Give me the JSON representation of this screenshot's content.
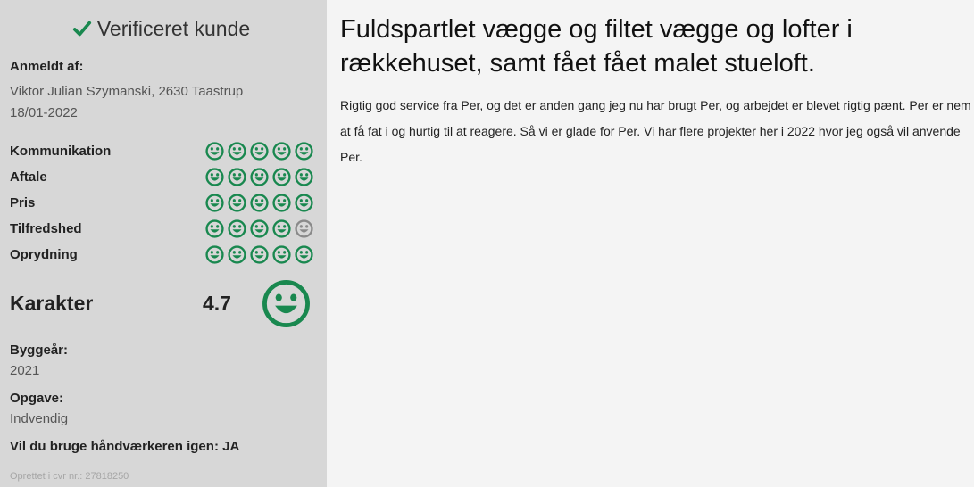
{
  "sidebar": {
    "verified_label": "Verificeret kunde",
    "reviewed_by_label": "Anmeldt af:",
    "reviewer": "Viktor Julian Szymanski, 2630 Taastrup",
    "date": "18/01-2022",
    "ratings": [
      {
        "label": "Kommunikation",
        "score": 5
      },
      {
        "label": "Aftale",
        "score": 5
      },
      {
        "label": "Pris",
        "score": 5
      },
      {
        "label": "Tilfredshed",
        "score": 4
      },
      {
        "label": "Oprydning",
        "score": 5
      }
    ],
    "grade_label": "Karakter",
    "grade_value": "4.7",
    "build_year_label": "Byggeår:",
    "build_year": "2021",
    "task_label": "Opgave:",
    "task": "Indvendig",
    "reuse": "Vil du bruge håndværkeren igen: JA",
    "cvr": "Oprettet i cvr nr.: 27818250"
  },
  "main": {
    "title": "Fuldspartlet vægge og filtet vægge og lofter i rækkehuset, samt fået fået malet stueloft.",
    "text": "Rigtig god service fra Per, og det er anden gang jeg nu har brugt Per, og arbejdet er blevet rigtig pænt. Per er nem at få fat i og hurtig til at reagere. Så vi er glade for Per. Vi har flere projekter her i 2022 hvor jeg også vil anvende Per."
  },
  "colors": {
    "accent_green": "#19884f",
    "inactive_gray": "#8a8a8a"
  },
  "icons": {
    "verified": "check-icon",
    "rating_face": "smiley-icon"
  }
}
